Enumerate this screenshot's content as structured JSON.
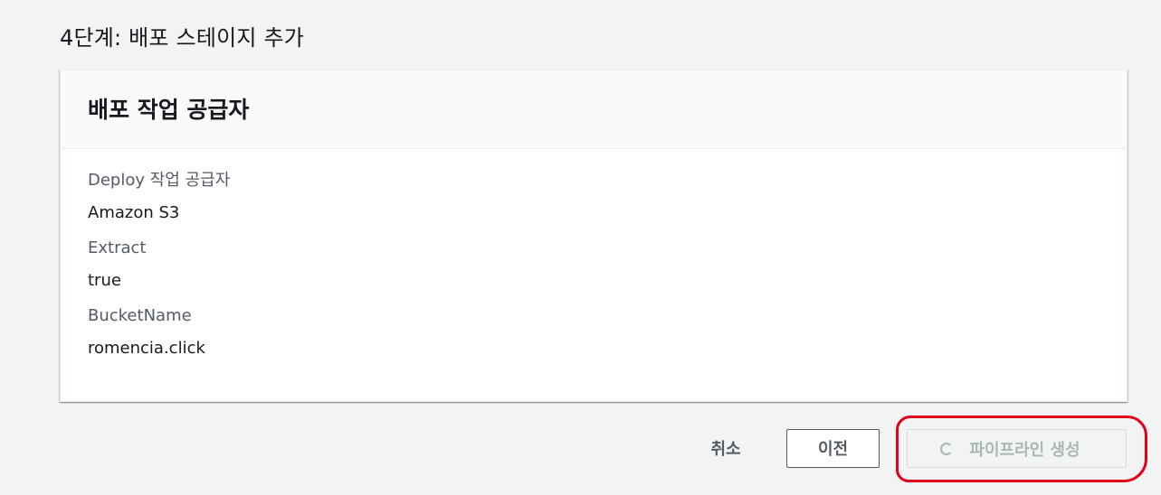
{
  "page": {
    "step_title": "4단계: 배포 스테이지 추가"
  },
  "panel": {
    "title": "배포 작업 공급자",
    "fields": [
      {
        "label": "Deploy 작업 공급자",
        "value": "Amazon S3"
      },
      {
        "label": "Extract",
        "value": "true"
      },
      {
        "label": "BucketName",
        "value": "romencia.click"
      }
    ]
  },
  "actions": {
    "cancel_label": "취소",
    "previous_label": "이전",
    "create_label": "파이프라인 생성",
    "create_state": "disabled-loading"
  },
  "colors": {
    "background": "#f2f3f3",
    "annotation": "#e0001b",
    "disabled_text": "#aab7b8"
  }
}
